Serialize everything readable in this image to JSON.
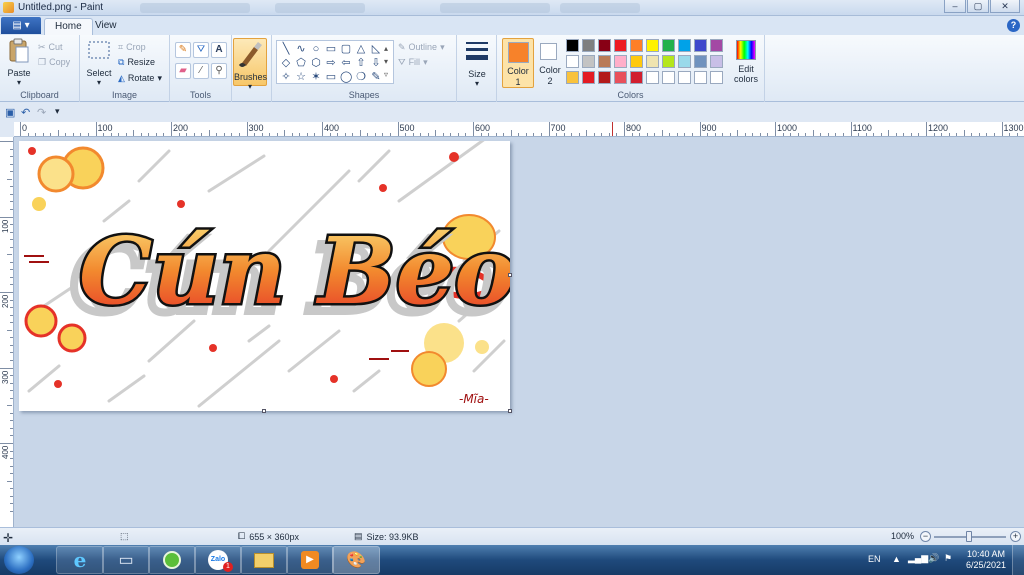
{
  "window": {
    "title": "Untitled.png - Paint",
    "minimize": "–",
    "maximize": "▢",
    "close": "✕"
  },
  "tabs": [
    {
      "label": "Home",
      "active": true
    },
    {
      "label": "View",
      "active": false
    }
  ],
  "help": "?",
  "ribbon": {
    "clipboard": {
      "label": "Clipboard",
      "paste": "Paste",
      "cut": "Cut",
      "copy": "Copy"
    },
    "image": {
      "label": "Image",
      "select": "Select",
      "crop": "Crop",
      "resize": "Resize",
      "rotate": "Rotate"
    },
    "tools": {
      "label": "Tools"
    },
    "brushes": {
      "label": "Brushes"
    },
    "shapes": {
      "label": "Shapes",
      "outline": "Outline",
      "fill": "Fill"
    },
    "size": {
      "label": "Size"
    },
    "colors": {
      "label": "Colors",
      "color1_label": "Color",
      "color1_index": "1",
      "color2_label": "Color",
      "color2_index": "2",
      "color1": "#f7822a",
      "color2": "#ffffff",
      "edit_label": "Edit",
      "edit_label2": "colors",
      "palette": [
        "#000000",
        "#7f7f7f",
        "#880015",
        "#ed1c24",
        "#ff7f27",
        "#fff200",
        "#22b14c",
        "#00a2e8",
        "#3f48cc",
        "#a349a4",
        "#ffffff",
        "#c3c3c3",
        "#b97a57",
        "#ffaec9",
        "#ffc90e",
        "#efe4b0",
        "#b5e61d",
        "#99d9ea",
        "#7092be",
        "#c8bfe7",
        "#f9c23c",
        "#e31b23",
        "#b31b1b",
        "#e8505b",
        "#d11f2f",
        "#ffffff",
        "#ffffff",
        "#ffffff",
        "#ffffff",
        "#ffffff"
      ]
    }
  },
  "ruler": {
    "h_labels": [
      "0",
      "100",
      "200",
      "300",
      "400",
      "500",
      "600",
      "700",
      "800",
      "900",
      "1000",
      "1100",
      "1200",
      "1300"
    ],
    "v_labels": [
      "100",
      "200",
      "300",
      "400"
    ]
  },
  "status": {
    "dimensions": "655 × 360px",
    "size": "Size: 93.9KB",
    "zoom": "100%",
    "zoom_out": "−",
    "zoom_in": "+"
  },
  "drawing": {
    "title_text": "Cún Béo",
    "signature": "-Mĩa-",
    "colors": {
      "yellow": "#f9d25a",
      "orange": "#f2892e",
      "red": "#e53228",
      "gray": "#c8c8c8",
      "black": "#111111"
    }
  },
  "taskbar": {
    "lang": "EN",
    "time": "10:40 AM",
    "date": "6/25/2021",
    "zalo_badge": "1"
  }
}
